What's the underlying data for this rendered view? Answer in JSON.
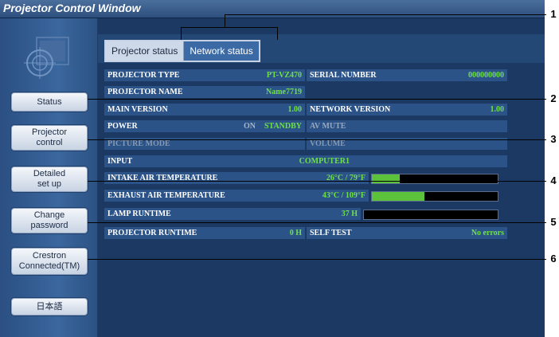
{
  "window": {
    "title": "Projector Control Window"
  },
  "nav": [
    {
      "id": "status",
      "label": "Status"
    },
    {
      "id": "projector-control",
      "label": "Projector\ncontrol"
    },
    {
      "id": "detailed-setup",
      "label": "Detailed\nset up"
    },
    {
      "id": "change-password",
      "label": "Change\npassword"
    },
    {
      "id": "crestron",
      "label": "Crestron\nConnected(TM)"
    },
    {
      "id": "japanese",
      "label": "日本語"
    }
  ],
  "tabs": [
    {
      "label": "Projector status",
      "active": false
    },
    {
      "label": "Network status",
      "active": true
    }
  ],
  "status": {
    "projector_type": {
      "label": "PROJECTOR TYPE",
      "value": "PT-VZ470"
    },
    "serial_number": {
      "label": "SERIAL NUMBER",
      "value": "000000000"
    },
    "projector_name": {
      "label": "PROJECTOR NAME",
      "value": "Name7719"
    },
    "main_version": {
      "label": "MAIN VERSION",
      "value": "1.00"
    },
    "network_version": {
      "label": "NETWORK VERSION",
      "value": "1.00"
    },
    "power": {
      "label": "POWER",
      "on": "ON",
      "standby": "STANDBY"
    },
    "av_mute": {
      "label": "AV MUTE"
    },
    "picture_mode": {
      "label": "PICTURE MODE"
    },
    "volume": {
      "label": "VOLUME"
    },
    "input": {
      "label": "INPUT",
      "value": "COMPUTER1"
    },
    "intake_air_temp": {
      "label": "INTAKE AIR TEMPERATURE",
      "value": "26°C / 79°F",
      "level": 0.22
    },
    "exhaust_air_temp": {
      "label": "EXHAUST AIR TEMPERATURE",
      "value": "43°C / 109°F",
      "level": 0.42
    },
    "lamp_runtime": {
      "label": "LAMP RUNTIME",
      "value": "37 H",
      "level": 0.0
    },
    "projector_runtime": {
      "label": "PROJECTOR RUNTIME",
      "value": "0 H"
    },
    "self_test": {
      "label": "SELF TEST",
      "value": "No errors"
    }
  },
  "callouts": [
    "1",
    "2",
    "3",
    "4",
    "5",
    "6"
  ],
  "colors": {
    "accent": "#6fe04a",
    "panel": "#2b5387",
    "background": "#1c3964"
  }
}
